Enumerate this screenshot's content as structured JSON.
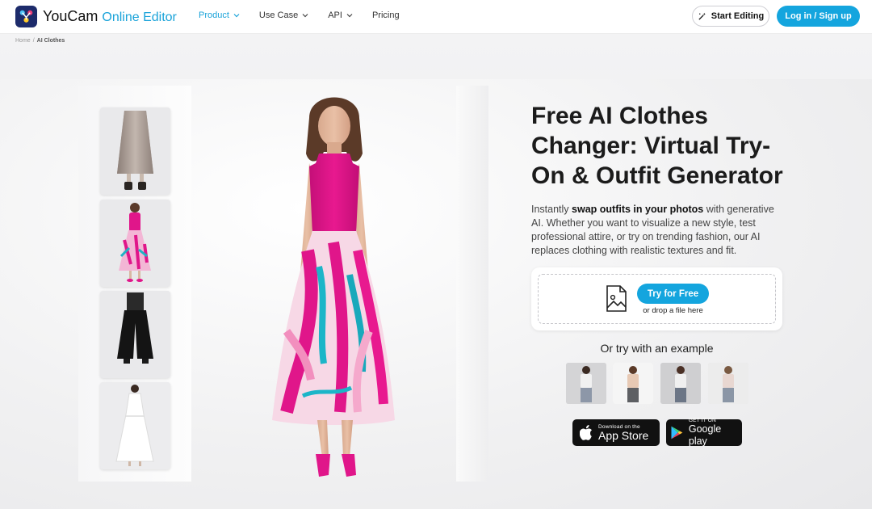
{
  "brand": {
    "name": "YouCam",
    "subtitle": "Online Editor",
    "accent": "#1aa3d9"
  },
  "nav": {
    "items": [
      {
        "label": "Product",
        "dropdown": true
      },
      {
        "label": "Use Case",
        "dropdown": true
      },
      {
        "label": "API",
        "dropdown": true
      },
      {
        "label": "Pricing",
        "dropdown": false
      }
    ],
    "start_label": "Start Editing",
    "login_label": "Log in / Sign up"
  },
  "breadcrumb": {
    "home": "Home",
    "separator": "/",
    "current": "AI Clothes"
  },
  "hero": {
    "headline": "Free AI Clothes Changer: Virtual Try-On & Outfit Generator",
    "desc_prefix": "Instantly ",
    "desc_bold": "swap outfits in your photos",
    "desc_suffix": " with generative AI. Whether you want to visualize a new style, test professional attire, or try on trending fashion, our AI replaces clothing with realistic textures and fit."
  },
  "upload": {
    "button_label": "Try for Free",
    "drop_label": "or drop a file here",
    "icon": "image-upload-icon"
  },
  "examples": {
    "title": "Or try with an example",
    "items": [
      "example-1",
      "example-2",
      "example-3",
      "example-4"
    ]
  },
  "stores": {
    "apple_small": "Download on the",
    "apple_big": "App Store",
    "google_small": "GET IT ON",
    "google_big": "Google play"
  },
  "outfits": [
    "beige-pleated-skirt",
    "pink-floral-dress",
    "black-wide-pants",
    "white-sleeveless-dress"
  ],
  "colors": {
    "primary": "#14a5de",
    "dress_pink": "#e0168a",
    "logo_bg": "#1d2b6b"
  }
}
